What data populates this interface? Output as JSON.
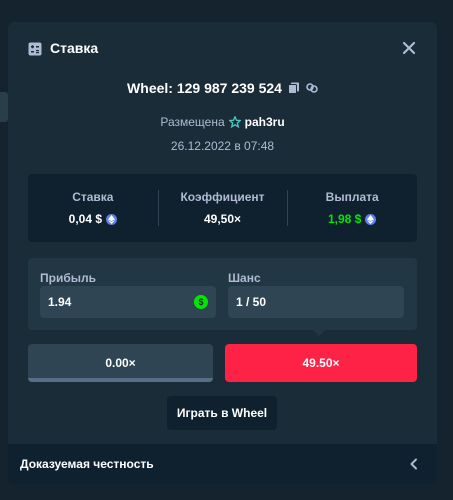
{
  "modal": {
    "title": "Ставка",
    "bet_id": "Wheel: 129 987 239 524",
    "placed_label": "Размещена",
    "username": "pah3ru",
    "datetime": "26.12.2022 в 07:48"
  },
  "stats": {
    "bet_label": "Ставка",
    "bet_value": "0,04 $",
    "multiplier_label": "Коэффициент",
    "multiplier_value": "49,50×",
    "payout_label": "Выплата",
    "payout_value": "1,98 $"
  },
  "calc": {
    "profit_label": "Прибыль",
    "profit_value": "1.94",
    "coin_symbol": "$",
    "chance_label": "Шанс",
    "chance_value": "1 / 50"
  },
  "segments": {
    "left_label": "0.00×",
    "right_label": "49.50×"
  },
  "play_button": "Играть в Wheel",
  "footer": {
    "label": "Доказуемая честность"
  },
  "colors": {
    "accent_red": "#fe2247",
    "win_green": "#00e701",
    "eth_blue": "#627eea"
  }
}
